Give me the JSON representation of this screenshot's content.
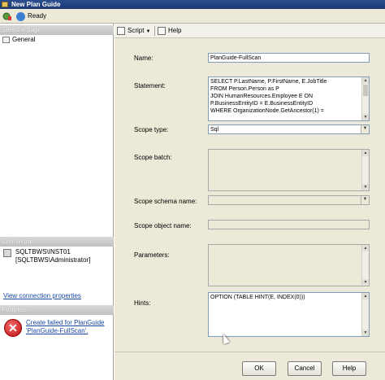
{
  "window": {
    "title": "New Plan Guide"
  },
  "status": {
    "text": "Ready"
  },
  "sidebar": {
    "select_page_header": "Select a page",
    "pages": [
      {
        "label": "General"
      }
    ],
    "connection_header": "Connection",
    "connection_server": "SQLTBWS\\INST01",
    "connection_user": "[SQLTBWS\\Administrator]",
    "view_connection_link": "View connection properties",
    "progress_header": "Progress",
    "progress_link_line1": "Create failed for PlanGuide",
    "progress_link_line2": "'PlanGuide-FullScan'."
  },
  "toolbar": {
    "script_label": "Script",
    "help_label": "Help"
  },
  "form": {
    "name_label": "Name:",
    "name_value": "PlanGuide-FullScan",
    "statement_label": "Statement:",
    "statement_lines": [
      "SELECT P.LastName, P.FirstName, E.JobTitle",
      "FROM Person.Person as P",
      "JOIN HumanResources.Employee E ON",
      "P.BusinessEntityID = E.BusinessEntityID",
      "WHERE OrganizationNode.GetAncestor(1) ="
    ],
    "scope_type_label": "Scope type:",
    "scope_type_value": "Sql",
    "scope_batch_label": "Scope batch:",
    "scope_schema_label": "Scope schema name:",
    "scope_object_label": "Scope object name:",
    "parameters_label": "Parameters:",
    "hints_label": "Hints:",
    "hints_value": "OPTION (TABLE HINT(E, INDEX(0)))"
  },
  "buttons": {
    "ok": "OK",
    "cancel": "Cancel",
    "help": "Help"
  }
}
